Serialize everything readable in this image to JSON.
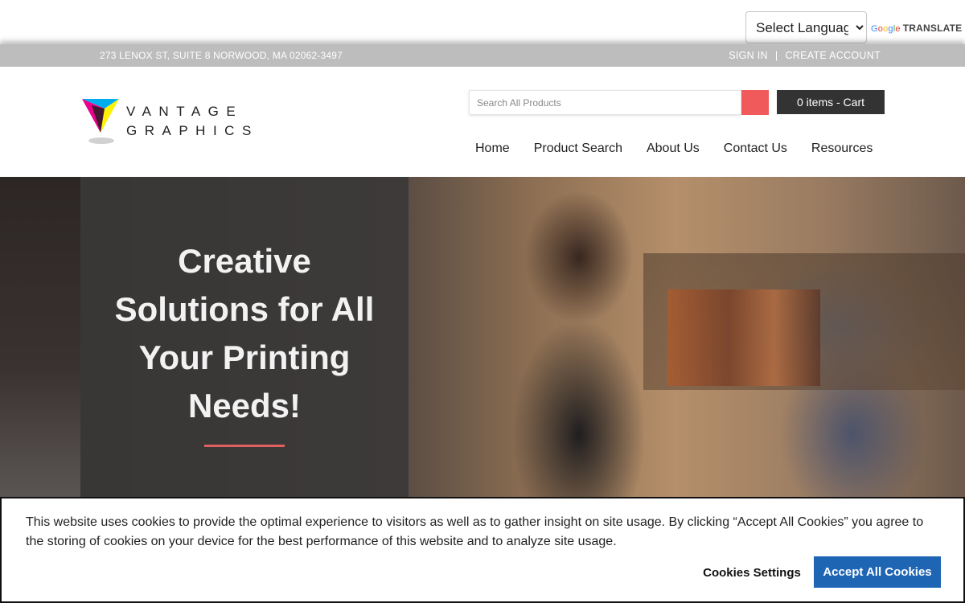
{
  "translate": {
    "language_select": "Select Language",
    "google": [
      "G",
      "o",
      "o",
      "g",
      "l",
      "e"
    ],
    "label": "TRANSLATE"
  },
  "info_bar": {
    "address": "273 LENOX ST, SUITE 8 NORWOOD, MA 02062-3497",
    "sign_in": "SIGN IN",
    "separator": "|",
    "create_account": "CREATE ACCOUNT"
  },
  "header": {
    "logo_line1": "VANTAGE",
    "logo_line2": "GRAPHICS",
    "search_placeholder": "Search All Products",
    "cart_label": "0 items - Cart",
    "nav": [
      "Home",
      "Product Search",
      "About Us",
      "Contact Us",
      "Resources"
    ]
  },
  "hero": {
    "title_lines": [
      "Creative",
      "Solutions for All",
      "Your Printing",
      "Needs!"
    ]
  },
  "cookie": {
    "text": "This website uses cookies to provide the optimal experience to visitors as well as to gather insight on site usage. By clicking “Accept All Cookies” you agree to the storing of cookies on your device for the best performance of this website and to analyze site usage.",
    "settings_label": "Cookies Settings",
    "accept_label": "Accept All Cookies"
  },
  "colors": {
    "accent": "#f05a5a",
    "cart_bg": "#333333",
    "accept_bg": "#1e66b4",
    "info_bar_bg": "#bdbdbd"
  }
}
